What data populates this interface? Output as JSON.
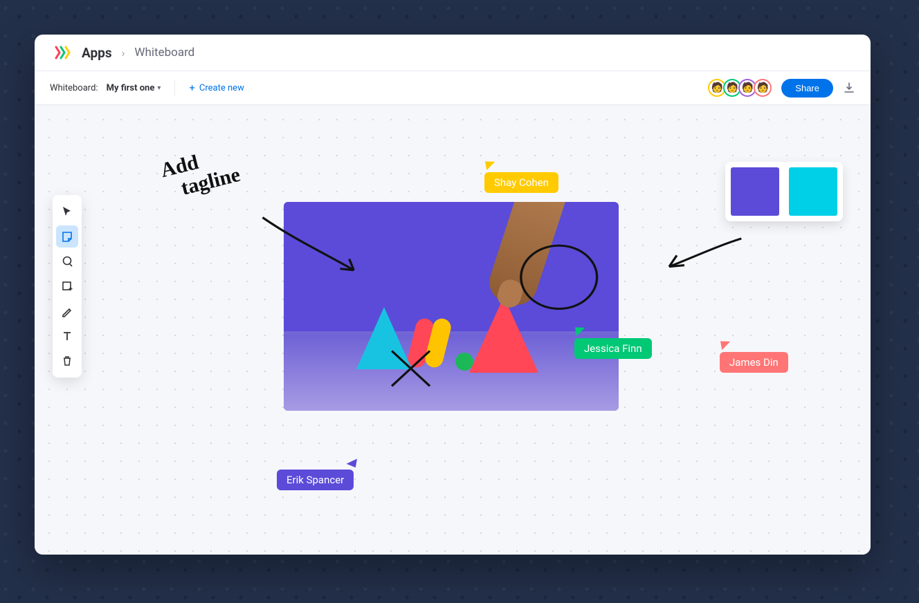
{
  "header": {
    "apps_label": "Apps",
    "page_title": "Whiteboard"
  },
  "subheader": {
    "whiteboard_label": "Whiteboard:",
    "current_name": "My first one",
    "create_label": "Create new",
    "share_label": "Share"
  },
  "collaborators": [
    {
      "ring": "y"
    },
    {
      "ring": "g"
    },
    {
      "ring": "p"
    },
    {
      "ring": "r"
    }
  ],
  "toolbar": {
    "items": [
      {
        "name": "select-tool",
        "icon": "cursor"
      },
      {
        "name": "sticky-note-tool",
        "icon": "note",
        "selected": true
      },
      {
        "name": "lasso-tool",
        "icon": "lasso"
      },
      {
        "name": "shape-tool",
        "icon": "shape"
      },
      {
        "name": "pen-tool",
        "icon": "pen"
      },
      {
        "name": "text-tool",
        "icon": "text"
      },
      {
        "name": "delete-tool",
        "icon": "trash"
      }
    ]
  },
  "cursors": {
    "shay": {
      "label": "Shay Cohen",
      "color": "#ffcb00"
    },
    "jessica": {
      "label": "Jessica Finn",
      "color": "#00c875"
    },
    "james": {
      "label": "James Din",
      "color": "#ff7575"
    },
    "erik": {
      "label": "Erik Spancer",
      "color": "#5b4bd8"
    }
  },
  "annotation_text": "Add\n   tagline",
  "swatches": [
    "#5b4bd8",
    "#00cfe8"
  ]
}
